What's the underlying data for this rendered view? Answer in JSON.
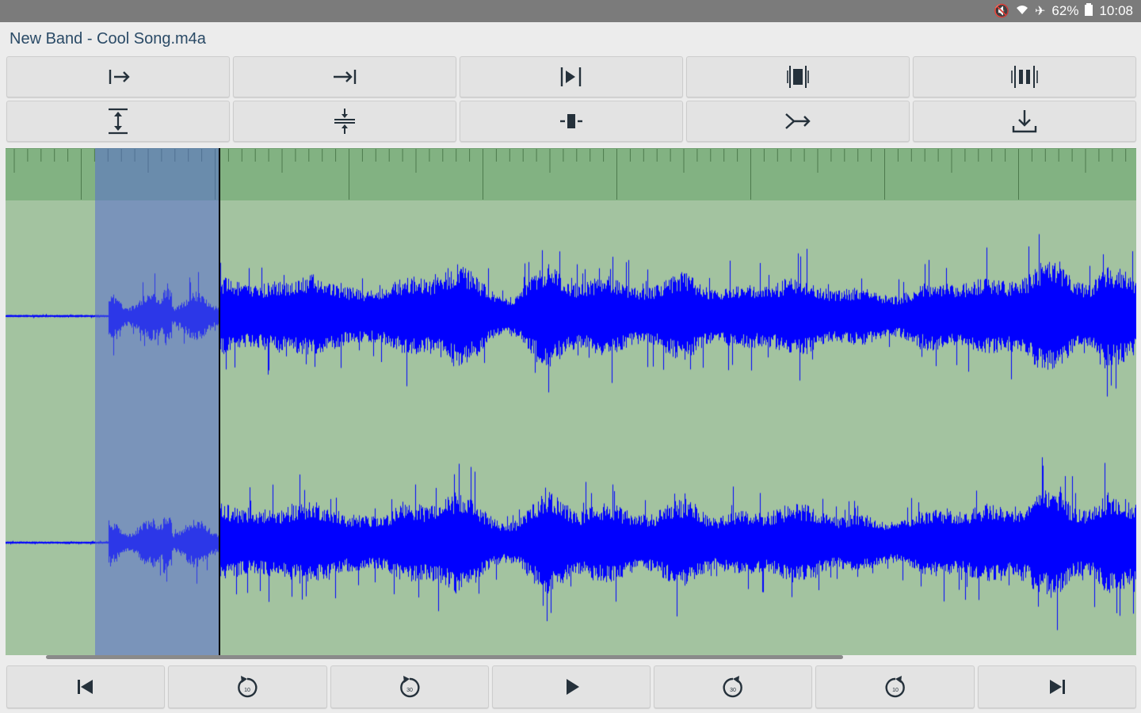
{
  "status_bar": {
    "battery": "62%",
    "time": "10:08",
    "icons": [
      "mute-icon",
      "wifi-icon",
      "airplane-icon",
      "battery-icon"
    ]
  },
  "file": {
    "title": "New Band - Cool Song.m4a"
  },
  "toolbar": {
    "row1": [
      "set-start-icon",
      "set-end-icon",
      "play-selection-icon",
      "select-region-icon",
      "split-region-icon"
    ],
    "row2": [
      "expand-vertical-icon",
      "compress-vertical-icon",
      "zoom-fit-icon",
      "merge-icon",
      "download-icon"
    ]
  },
  "transport": {
    "skip_back_label": "10",
    "skip_back_far_label": "30",
    "skip_forward_far_label": "30",
    "skip_forward_label": "10",
    "icons": [
      "skip-to-start-icon",
      "rewind-10-icon",
      "rewind-30-icon",
      "play-icon",
      "forward-30-icon",
      "forward-10-icon",
      "skip-to-end-icon"
    ]
  },
  "colors": {
    "waveform": "#0000ff",
    "waveform_bg": "#a3c3a0",
    "ruler_bg": "#82b282",
    "selection": "#5569d2",
    "status_bar": "#7b7b7b"
  },
  "selection": {
    "start_fraction": 0.08,
    "end_fraction": 0.19
  },
  "playhead": {
    "fraction": 0.19
  }
}
